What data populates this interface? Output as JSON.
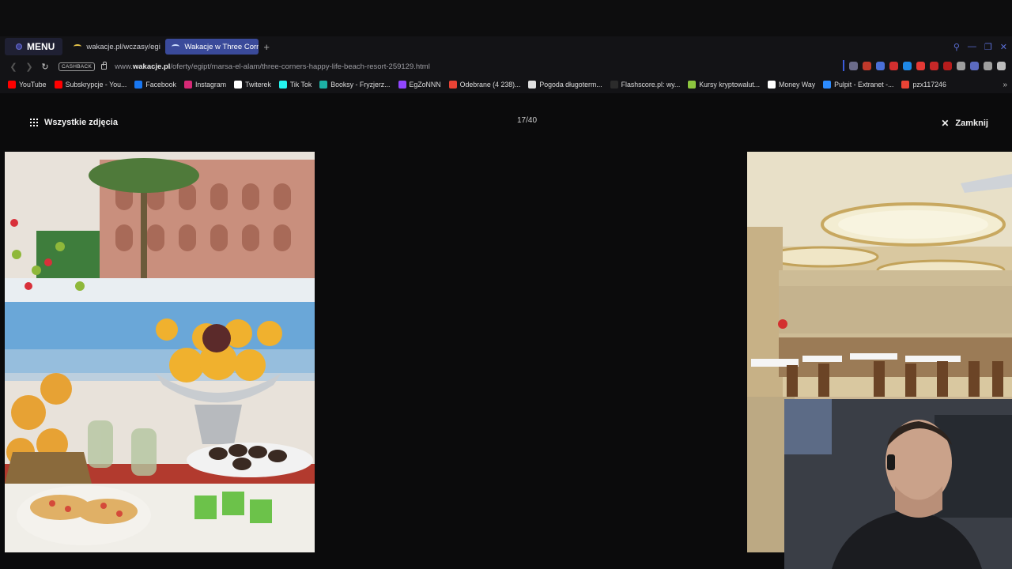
{
  "browser": {
    "menu_label": "MENU",
    "tabs": [
      {
        "label": "wakacje.pl/wczasy/egipt/"
      },
      {
        "label": "Wakacje w Three Corners"
      }
    ],
    "new_tab_icon": "plus-icon",
    "address": {
      "cashback_label": "CASHBACK",
      "url_prefix": "www.",
      "url_domain": "wakacje.pl",
      "url_path": "/oferty/egipt/marsa-el-alam/three-corners-happy-life-beach-resort-259129.html"
    },
    "bookmarks": [
      {
        "label": "YouTube",
        "color": "#ff0000"
      },
      {
        "label": "Subskrypcje - You...",
        "color": "#ff0000"
      },
      {
        "label": "Facebook",
        "color": "#1877f2"
      },
      {
        "label": "Instagram",
        "color": "#d62976"
      },
      {
        "label": "Twiterek",
        "color": "#ffffff"
      },
      {
        "label": "Tik Tok",
        "color": "#25f4ee"
      },
      {
        "label": "Booksy - Fryzjerz...",
        "color": "#1db1a5"
      },
      {
        "label": "EgZoNNN",
        "color": "#9146ff"
      },
      {
        "label": "Odebrane (4 238)...",
        "color": "#ea4335"
      },
      {
        "label": "Pogoda długoterm...",
        "color": "#e0e0e0"
      },
      {
        "label": "Flashscore.pl: wy...",
        "color": "#2b2b2b"
      },
      {
        "label": "Kursy kryptowalut...",
        "color": "#8dc63f"
      },
      {
        "label": "Money Way",
        "color": "#ffffff"
      },
      {
        "label": "Pulpit - Extranet -...",
        "color": "#2d8cff"
      },
      {
        "label": "pzx117246",
        "color": "#ea4335"
      }
    ]
  },
  "viewer": {
    "all_photos_label": "Wszystkie zdjęcia",
    "counter": "17/40",
    "close_label": "Zamknij"
  },
  "colors": {
    "accent": "#3a4a9a",
    "background": "#0b0b0c"
  }
}
